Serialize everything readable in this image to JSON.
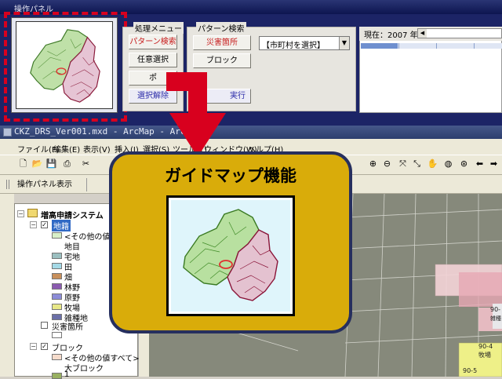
{
  "op_panel": {
    "title": "操作パネル",
    "menu_group": {
      "title": "処理メニュー",
      "buttons": [
        "パターン検索",
        "任意選択",
        "ポ",
        "選択解除"
      ]
    },
    "pattern_group": {
      "title": "パターン検索",
      "buttons": [
        "災害箇所",
        "ブロック",
        "実行"
      ],
      "combo_value": "【市町村を選択】"
    },
    "year": {
      "label": "現在：2007 年",
      "progress": 0.26
    }
  },
  "arcmap": {
    "title": "CKZ_DRS_Ver001.mxd - ArcMap - ArcView",
    "menus": [
      "ファイル(F)",
      "編集(E)",
      "表示(V)",
      "挿入(I)",
      "選択(S)",
      "ツール(T)",
      "ウィンドウ(W)",
      "ヘルプ(H)"
    ],
    "toolbar2_button": "操作パネル表示",
    "toc": {
      "root": "増高申請システム",
      "layers": [
        {
          "name": "地籍",
          "checked": true,
          "legend": [
            {
              "label": "<その他の値すべて>",
              "color": "#d8f0c8"
            },
            {
              "label": "地目",
              "color": ""
            },
            {
              "label": "宅地",
              "color": "#9bbfc0"
            },
            {
              "label": "田",
              "color": "#a4d9e6"
            },
            {
              "label": "畑",
              "color": "#c8905c"
            },
            {
              "label": "林野",
              "color": "#8b5bb0"
            },
            {
              "label": "原野",
              "color": "#8c8cd8"
            },
            {
              "label": "牧場",
              "color": "#e8e888"
            },
            {
              "label": "雑種地",
              "color": "#6b6fa8"
            }
          ]
        },
        {
          "name": "災害箇所",
          "checked": false,
          "legend": []
        },
        {
          "name": "ブロック",
          "checked": true,
          "legend": [
            {
              "label": "<その他の値すべて>",
              "color": "#f6dccc"
            },
            {
              "label": "大ブロック",
              "color": ""
            },
            {
              "label": "1",
              "color": "#98b060"
            }
          ]
        }
      ]
    },
    "map_labels": [
      "90-",
      "90-4",
      "牧場",
      "90-5",
      "雑種"
    ]
  },
  "callout": {
    "title": "ガイドマップ機能"
  },
  "colors": {
    "panel_navy": "#1c2466",
    "highlight_red": "#d8001e",
    "callout_gold": "#d9ac0a",
    "callout_border": "#262f5e"
  }
}
